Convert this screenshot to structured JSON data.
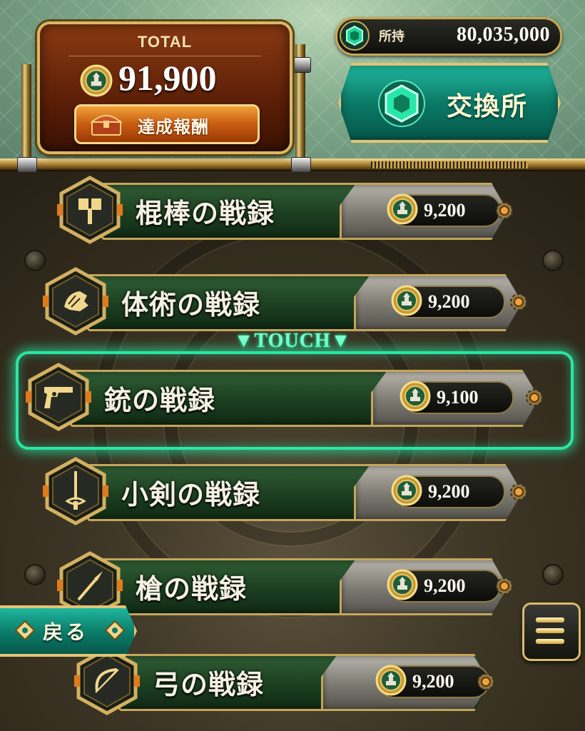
{
  "header": {
    "total_label": "TOTAL",
    "total_value": "91,900",
    "reward_label": "達成報酬",
    "possession_label": "所持",
    "possession_value": "80,035,000",
    "exchange_label": "交換所"
  },
  "records": [
    {
      "title": "棍棒の戦録",
      "price": "9,200",
      "icon": "hammer-icon"
    },
    {
      "title": "体術の戦録",
      "price": "9,200",
      "icon": "fist-icon"
    },
    {
      "title": "銃の戦録",
      "price": "9,100",
      "icon": "pistol-icon",
      "highlighted": true
    },
    {
      "title": "小剣の戦録",
      "price": "9,200",
      "icon": "rapier-icon"
    },
    {
      "title": "槍の戦録",
      "price": "9,200",
      "icon": "spear-icon"
    },
    {
      "title": "弓の戦録",
      "price": "9,200",
      "icon": "bow-icon"
    }
  ],
  "touch_hint": "▼TOUCH▼",
  "back_label": "戻る",
  "colors": {
    "highlight": "#2ae6a4",
    "gold": "#c4a55a",
    "row_green": "#1c3f21",
    "teal": "#0b7a67"
  }
}
